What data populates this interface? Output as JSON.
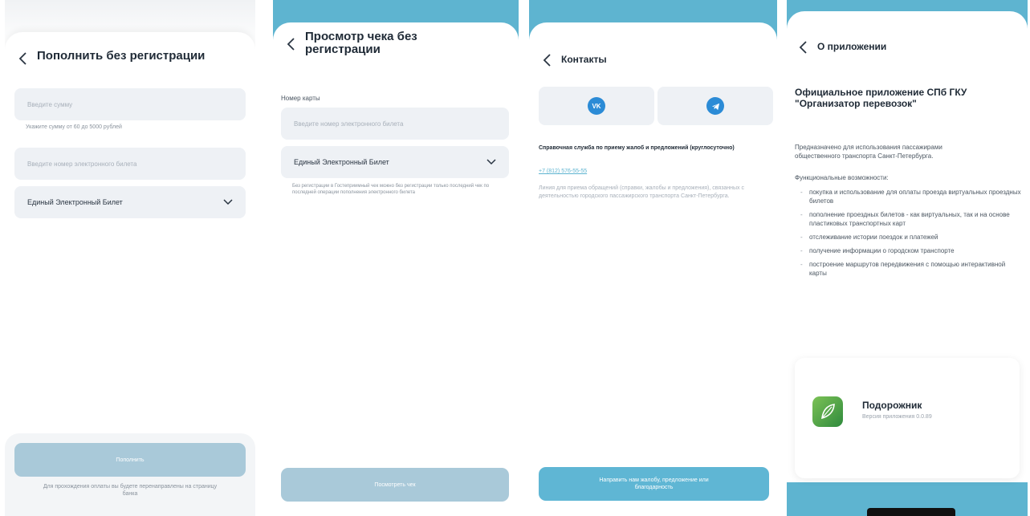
{
  "screen1": {
    "title": "Пополнить без регистрации",
    "amount_placeholder": "Введите сумму",
    "amount_hint": "Укажите сумму от 60 до 5000 рублей",
    "ticket_placeholder": "Введите номер электронного билета",
    "ticket_type": "Единый Электронный Билет",
    "button_label": "Пополнить",
    "footer_note": "Для прохождения оплаты вы будете перенаправлены на страницу банка"
  },
  "screen2": {
    "title": "Просмотр чека без регистрации",
    "card_label": "Номер карты",
    "ticket_placeholder": "Введите номер электронного билета",
    "ticket_type": "Единый Электронный Билет",
    "hint": "Без регистрации в Гостеприимный чек можно без регистрации только последний чек по последней операции пополнения электронного билета",
    "button_label": "Посмотреть чек"
  },
  "screen3": {
    "title": "Контакты",
    "vk_label": "VK",
    "support_heading": "Справочная служба по приему жалоб и предложений (круглосуточно)",
    "phone": "+7 (812) 576-55-55",
    "description": "Линия для приема обращений (справки, жалобы и предложения), связанных с деятельностью городского пассажирского транспорта Санкт-Петербурга.",
    "button_label": "Направить нам жалобу, предложение или благодарность"
  },
  "screen4": {
    "title": "О приложении",
    "heading": "Официальное приложение СПб ГКУ \"Организатор перевозок\"",
    "intro": "Предназначено для использования пассажирами общественного транспорта Санкт-Петербурга.",
    "features_title": "Функциональные возможности:",
    "features": [
      "покупка и использование для оплаты проезда виртуальных проездных билетов",
      "пополнение проездных билетов - как виртуальных, так и на основе пластиковых транспортных карт",
      "отслеживание истории поездок и платежей",
      "получение информации о городском транспорте",
      "построение маршрутов передвижения с помощью интерактивной карты"
    ],
    "app_name": "Подорожник",
    "app_version": "Версия приложения 0.0.89"
  },
  "colors": {
    "accent": "#5eb4d0",
    "button_disabled": "#a9c9d9",
    "input_bg": "#eef1f5",
    "vk": "#2b8bd6",
    "telegram": "#2b8bd6"
  }
}
